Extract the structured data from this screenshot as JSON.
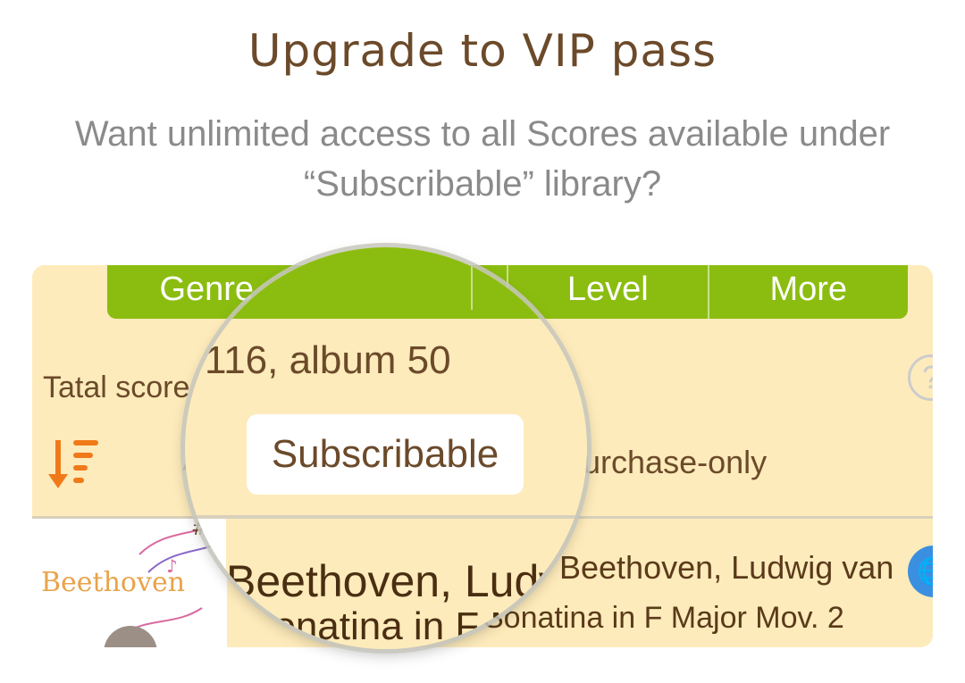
{
  "header": {
    "title": "Upgrade to VIP pass",
    "subtitle": "Want unlimited access to all Scores available under “Subscribable” library?"
  },
  "tabs": [
    {
      "label": "Genre"
    },
    {
      "label": ""
    },
    {
      "label": "Level"
    },
    {
      "label": "More"
    }
  ],
  "library": {
    "total_prefix": "Tatal score",
    "total_zoomed": "116, album 50",
    "help_label": "?",
    "filters": {
      "all_partial": "A",
      "subscribable": "Subscribable",
      "purchase_only": "Purchase-only"
    }
  },
  "list": {
    "items": [
      {
        "thumb_text": "Beethoven",
        "composer": "Beethoven, Ludwig van",
        "piece": "Sonatina in F Major Mov. 2",
        "badge_icon": "globe-icon"
      }
    ]
  },
  "colors": {
    "title": "#6b4a2a",
    "tab_green": "#8bbd10",
    "panel_bg": "#fdebbb",
    "accent_orange": "#f07a1a",
    "badge_blue": "#3b8fe0"
  }
}
